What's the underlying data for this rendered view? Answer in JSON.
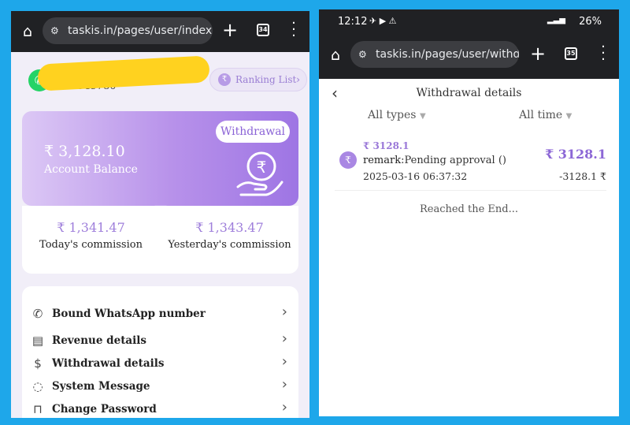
{
  "left": {
    "browser": {
      "url": "taskis.in/pages/user/index",
      "tab_count": "34"
    },
    "user": {
      "id": "ID:545780",
      "ranking_label": "Ranking List"
    },
    "balance": {
      "withdrawal_button": "Withdrawal",
      "amount": "₹ 3,128.10",
      "label": "Account Balance"
    },
    "commission": {
      "today_value": "₹ 1,341.47",
      "today_label": "Today's commission",
      "yesterday_value": "₹ 1,343.47",
      "yesterday_label": "Yesterday's commission"
    },
    "menu": [
      {
        "label": "Bound WhatsApp number",
        "icon": "phone-icon"
      },
      {
        "label": "Revenue details",
        "icon": "document-icon"
      },
      {
        "label": "Withdrawal details",
        "icon": "money-bag-icon"
      },
      {
        "label": "System Message",
        "icon": "chat-icon"
      },
      {
        "label": "Change Password",
        "icon": "lock-icon"
      }
    ]
  },
  "right": {
    "status": {
      "time": "12:12",
      "battery": "26%"
    },
    "browser": {
      "url": "taskis.in/pages/user/withdrea",
      "tab_count": "35"
    },
    "page_title": "Withdrawal details",
    "filters": {
      "type": "All types",
      "time": "All time"
    },
    "record": {
      "amount_small": "₹ 3128.1",
      "remark_key": "remark",
      "remark_value": ":Pending approval ()",
      "datetime": "2025-03-16 06:37:32",
      "amount_large": "₹ 3128.1",
      "amount_net": "-3128.1 ₹"
    },
    "end_text": "Reached the End..."
  },
  "colors": {
    "frame": "#1ea7ea",
    "accent": "#9a78d8",
    "browser_bar": "#202124"
  }
}
